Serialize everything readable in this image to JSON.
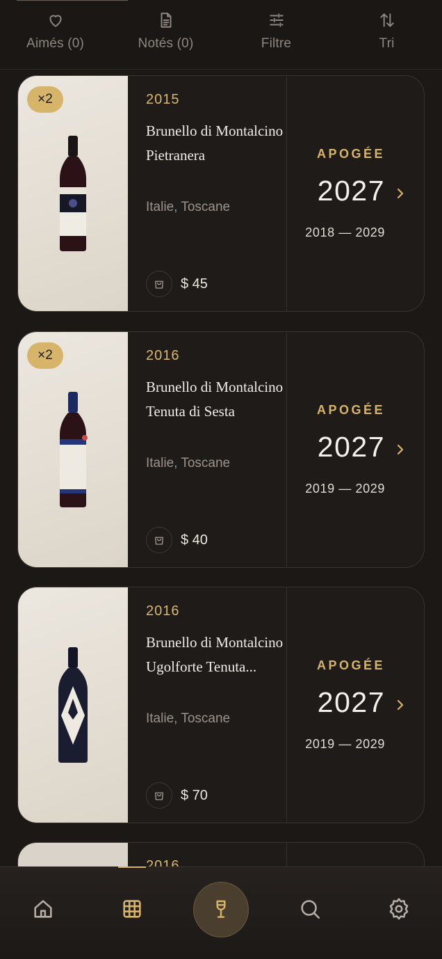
{
  "toolbar": {
    "liked_label": "Aimés (0)",
    "rated_label": "Notés (0)",
    "filter_label": "Filtre",
    "sort_label": "Tri"
  },
  "wines": [
    {
      "quantity": "×2",
      "vintage": "2015",
      "name": "Brunello di Montalcino Pietranera",
      "origin": "Italie, Toscane",
      "price": "$ 45",
      "apogee_label": "APOGÉE",
      "apogee_year": "2027",
      "window": "2018 — 2029"
    },
    {
      "quantity": "×2",
      "vintage": "2016",
      "name": "Brunello di Montalcino Tenuta di Sesta",
      "origin": "Italie, Toscane",
      "price": "$ 40",
      "apogee_label": "APOGÉE",
      "apogee_year": "2027",
      "window": "2019 — 2029"
    },
    {
      "quantity": "",
      "vintage": "2016",
      "name": "Brunello di Montalcino Ugolforte Tenuta...",
      "origin": "Italie, Toscane",
      "price": "$ 70",
      "apogee_label": "APOGÉE",
      "apogee_year": "2027",
      "window": "2019 — 2029"
    },
    {
      "vintage": "2016"
    }
  ],
  "bottom_nav": {
    "items": [
      "home-icon",
      "grid-icon",
      "wine-glass-icon",
      "search-icon",
      "gear-icon"
    ],
    "active": "grid-icon"
  },
  "colors": {
    "accent": "#d6b46a",
    "background": "#1c1816",
    "card": "#1f1b19"
  }
}
